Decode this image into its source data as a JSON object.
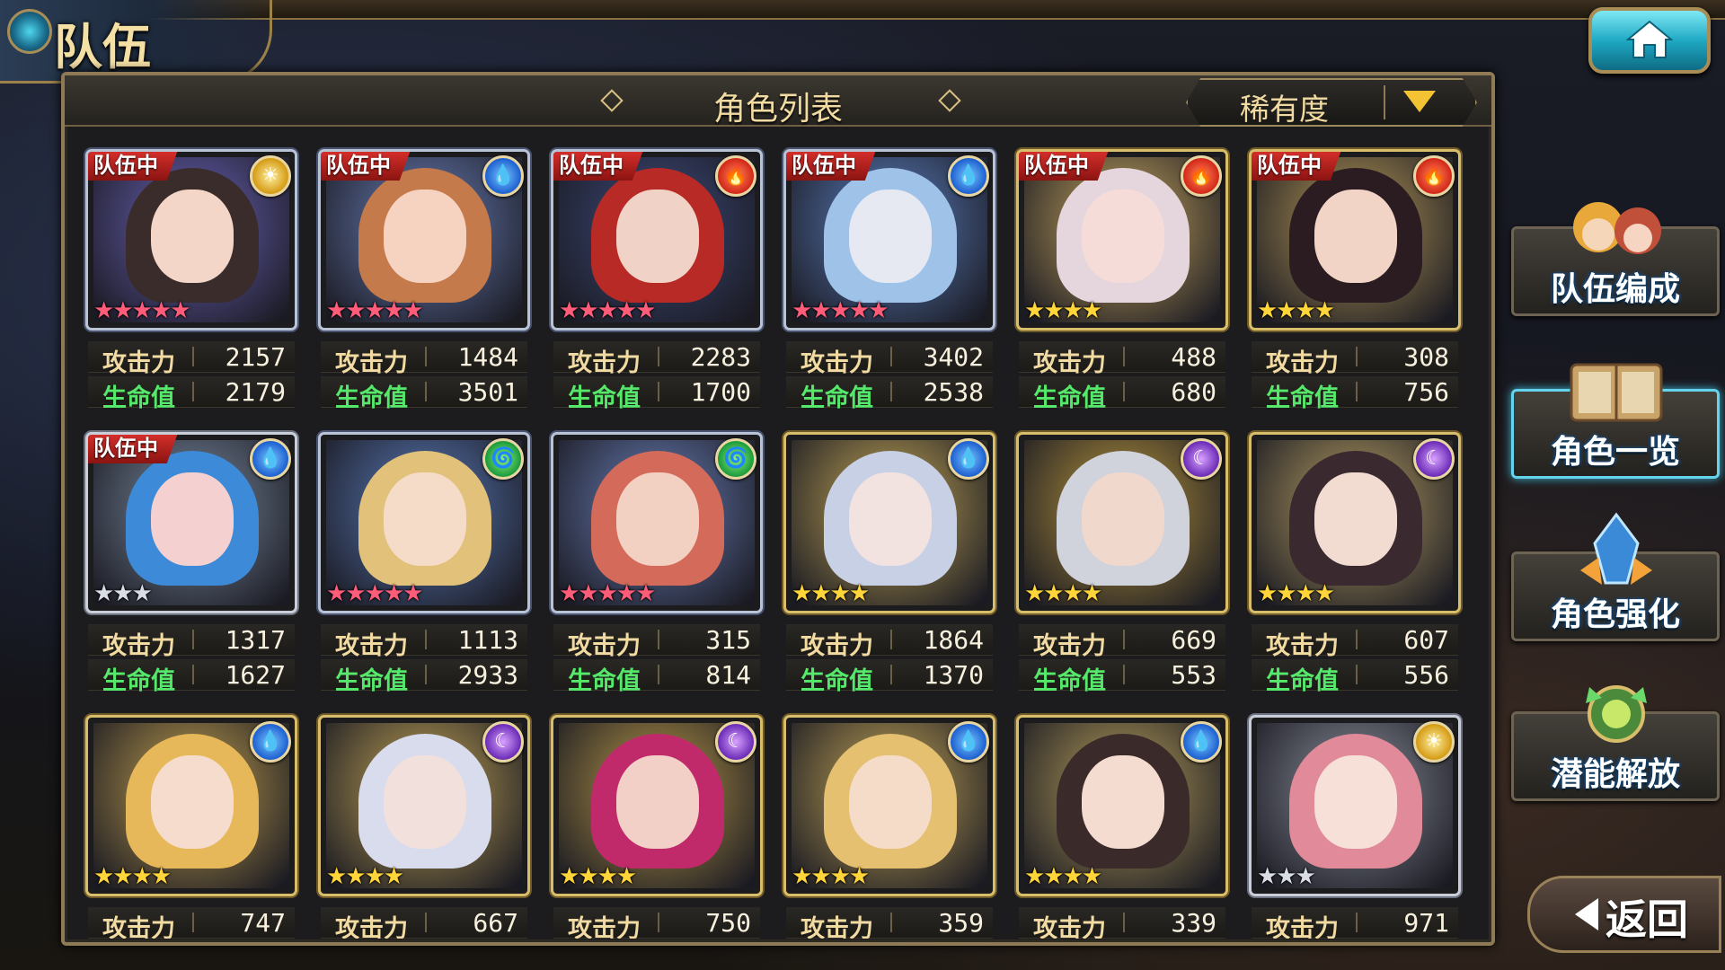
{
  "header": {
    "title": "队伍",
    "home_icon": "home-icon"
  },
  "panel": {
    "title": "角色列表",
    "sort_label": "稀有度",
    "sort_icon": "triangle-down-icon"
  },
  "labels": {
    "team_badge": "队伍中",
    "attack": "攻击力",
    "hp": "生命值"
  },
  "colors": {
    "team_badge": "#d8302c",
    "attack_label": "#f2dba2",
    "hp_label": "#55e86a",
    "active_menu": "#63d4ec"
  },
  "characters": [
    {
      "in_team": true,
      "element": "light",
      "element_icon": "sun-icon",
      "stars": 5,
      "attack": "2157",
      "hp": "2179"
    },
    {
      "in_team": true,
      "element": "water",
      "element_icon": "water-drop-icon",
      "stars": 5,
      "attack": "1484",
      "hp": "3501"
    },
    {
      "in_team": true,
      "element": "fire",
      "element_icon": "fire-icon",
      "stars": 5,
      "attack": "2283",
      "hp": "1700"
    },
    {
      "in_team": true,
      "element": "water",
      "element_icon": "water-drop-icon",
      "stars": 5,
      "attack": "3402",
      "hp": "2538"
    },
    {
      "in_team": true,
      "element": "fire",
      "element_icon": "fire-icon",
      "stars": 4,
      "attack": "488",
      "hp": "680"
    },
    {
      "in_team": true,
      "element": "fire",
      "element_icon": "fire-icon",
      "stars": 4,
      "attack": "308",
      "hp": "756"
    },
    {
      "in_team": true,
      "element": "water",
      "element_icon": "water-drop-icon",
      "stars": 3,
      "attack": "1317",
      "hp": "1627"
    },
    {
      "in_team": false,
      "element": "wind",
      "element_icon": "wind-icon",
      "stars": 5,
      "attack": "1113",
      "hp": "2933"
    },
    {
      "in_team": false,
      "element": "wind",
      "element_icon": "wind-icon",
      "stars": 5,
      "attack": "315",
      "hp": "814"
    },
    {
      "in_team": false,
      "element": "water",
      "element_icon": "water-drop-icon",
      "stars": 4,
      "attack": "1864",
      "hp": "1370"
    },
    {
      "in_team": false,
      "element": "dark",
      "element_icon": "moon-icon",
      "stars": 4,
      "attack": "669",
      "hp": "553"
    },
    {
      "in_team": false,
      "element": "dark",
      "element_icon": "moon-icon",
      "stars": 4,
      "attack": "607",
      "hp": "556"
    },
    {
      "in_team": false,
      "element": "water",
      "element_icon": "water-drop-icon",
      "stars": 4,
      "attack": "747",
      "hp": ""
    },
    {
      "in_team": false,
      "element": "dark",
      "element_icon": "moon-icon",
      "stars": 4,
      "attack": "667",
      "hp": ""
    },
    {
      "in_team": false,
      "element": "dark",
      "element_icon": "moon-icon",
      "stars": 4,
      "attack": "750",
      "hp": ""
    },
    {
      "in_team": false,
      "element": "water",
      "element_icon": "water-drop-icon",
      "stars": 4,
      "attack": "359",
      "hp": ""
    },
    {
      "in_team": false,
      "element": "water",
      "element_icon": "water-drop-icon",
      "stars": 4,
      "attack": "339",
      "hp": ""
    },
    {
      "in_team": false,
      "element": "light",
      "element_icon": "sun-icon",
      "stars": 3,
      "attack": "971",
      "hp": ""
    }
  ],
  "side_menu": [
    {
      "label": "队伍编成",
      "icon": "team-characters-icon",
      "active": false
    },
    {
      "label": "角色一览",
      "icon": "book-icon",
      "active": true
    },
    {
      "label": "角色强化",
      "icon": "enhance-crystal-icon",
      "active": false
    },
    {
      "label": "潜能解放",
      "icon": "potential-orb-icon",
      "active": false
    }
  ],
  "back": {
    "label": "返回",
    "icon": "back-arrow-icon"
  }
}
